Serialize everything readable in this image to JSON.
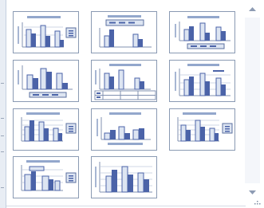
{
  "panel": {
    "accent": "#3d5a99",
    "thumb_border": "#8a9ab3",
    "bar_dark": "#4b63a8",
    "bar_light": "#dde5f2"
  },
  "layouts": [
    {
      "id": "layout-1"
    },
    {
      "id": "layout-2"
    },
    {
      "id": "layout-3"
    },
    {
      "id": "layout-4"
    },
    {
      "id": "layout-5"
    },
    {
      "id": "layout-6"
    },
    {
      "id": "layout-7"
    },
    {
      "id": "layout-8"
    },
    {
      "id": "layout-9"
    },
    {
      "id": "layout-10"
    },
    {
      "id": "layout-11"
    }
  ],
  "scrollbar": {
    "up_icon": "triangle-up",
    "down_icon": "triangle-down",
    "resize_icon": "dotted-grip"
  }
}
